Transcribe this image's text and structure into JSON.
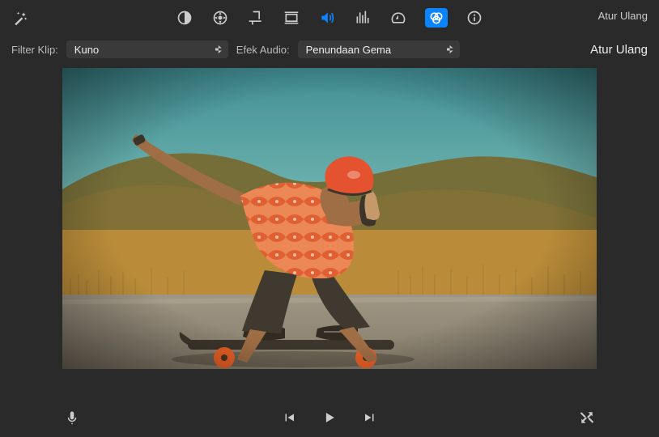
{
  "toolbar": {
    "reset_top": "Atur Ulang"
  },
  "filter": {
    "clip_label": "Filter Klip:",
    "clip_value": "Kuno",
    "audio_label": "Efek Audio:",
    "audio_value": "Penundaan Gema",
    "reset": "Atur Ulang"
  },
  "colors": {
    "accent": "#0b84ff",
    "helmet": "#e94a2f",
    "wheel": "#f15a24",
    "sky_top": "#2f8fa0",
    "sky_bottom": "#6fc3c8",
    "road": "#8c8981",
    "grass_far": "#6b6a3a",
    "grass_near": "#b98d3a",
    "shirt_base": "#f2875a",
    "shirt_pattern": "#e45a33",
    "skin": "#9b6a46"
  }
}
